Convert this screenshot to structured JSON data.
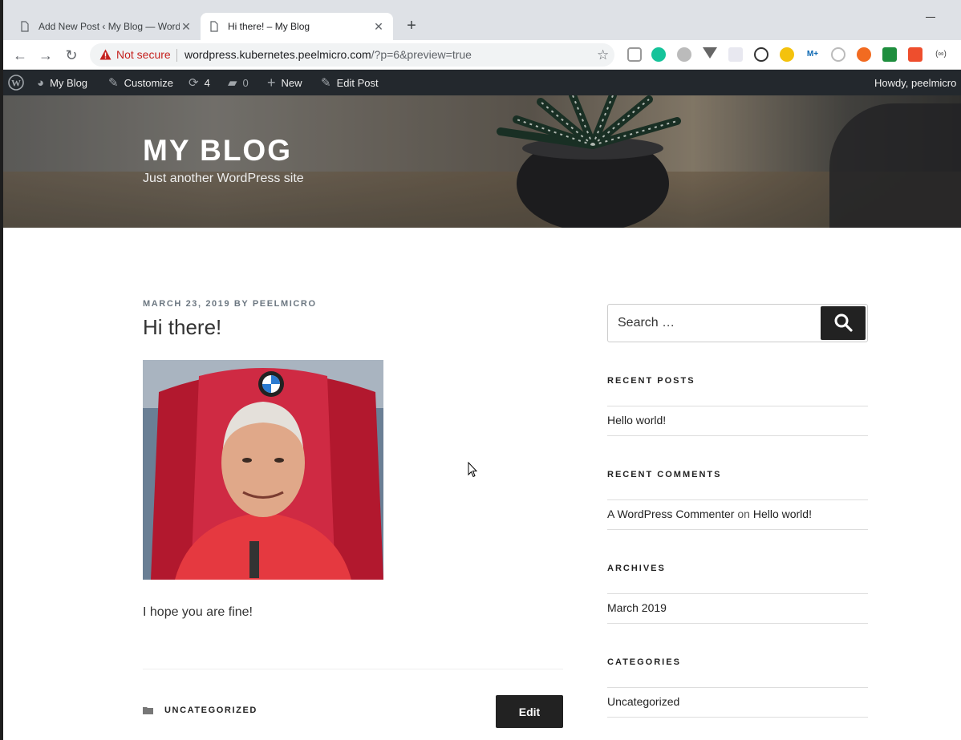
{
  "browser": {
    "tabs": [
      {
        "title": "Add New Post ‹ My Blog — WordPress",
        "active": false
      },
      {
        "title": "Hi there! – My Blog",
        "active": true
      }
    ],
    "new_tab_glyph": "+",
    "security_label": "Not secure",
    "url_host": "wordpress.kubernetes.peelmicro.com",
    "url_path": "/?p=6&preview=true",
    "extension_icons": [
      "cookie-icon",
      "grammarly-icon",
      "circle-ext-icon",
      "vue-devtools-icon",
      "grid-ext-icon",
      "code-ext-icon",
      "moon-ext-icon",
      "m-plus-icon",
      "react-icon",
      "x-ext-icon",
      "green-ext-icon",
      "s-ext-icon",
      "wave-ext-icon"
    ]
  },
  "admin_bar": {
    "site_name": "My Blog",
    "customize": "Customize",
    "updates_count": "4",
    "comments_count": "0",
    "new_label": "New",
    "edit_post": "Edit Post",
    "howdy": "Howdy, peelmicro"
  },
  "header": {
    "site_title": "MY BLOG",
    "site_description": "Just another WordPress site"
  },
  "post": {
    "date": "MARCH 23, 2019",
    "by": "BY",
    "author": "PEELMICRO",
    "title": "Hi there!",
    "body": "I hope you are fine!",
    "category": "UNCATEGORIZED",
    "edit_label": "Edit"
  },
  "sidebar": {
    "search_placeholder": "Search …",
    "recent_posts_title": "RECENT POSTS",
    "recent_posts": [
      "Hello world!"
    ],
    "recent_comments_title": "RECENT COMMENTS",
    "comment_author": "A WordPress Commenter",
    "comment_on": "on",
    "comment_post": "Hello world!",
    "archives_title": "ARCHIVES",
    "archives": [
      "March 2019"
    ],
    "categories_title": "CATEGORIES",
    "categories": [
      "Uncategorized"
    ]
  },
  "colors": {
    "admin_bar_bg": "#23282d",
    "button_bg": "#222222",
    "not_secure_red": "#c5221f"
  }
}
